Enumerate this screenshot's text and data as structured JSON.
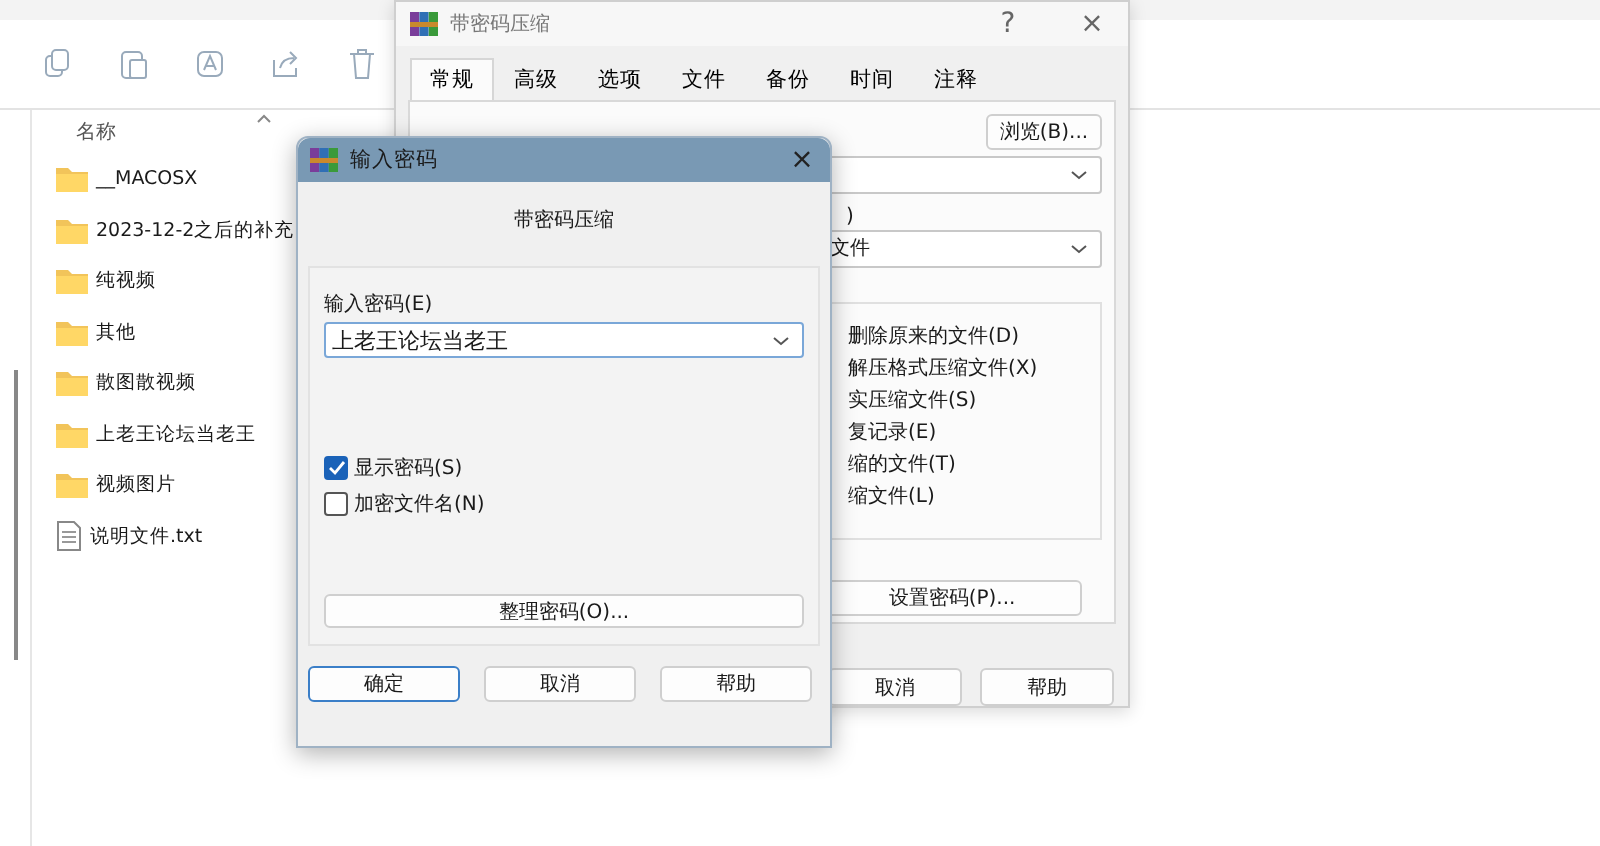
{
  "explorer": {
    "column_header": "名称",
    "items": [
      {
        "name": "__MACOSX",
        "kind": "folder"
      },
      {
        "name": "2023-12-2之后的补充",
        "kind": "folder"
      },
      {
        "name": "纯视频",
        "kind": "folder"
      },
      {
        "name": "其他",
        "kind": "folder"
      },
      {
        "name": "散图散视频",
        "kind": "folder"
      },
      {
        "name": "上老王论坛当老王",
        "kind": "folder"
      },
      {
        "name": "视频图片",
        "kind": "folder"
      },
      {
        "name": "说明文件.txt",
        "kind": "file"
      }
    ]
  },
  "archive_dialog": {
    "title": "带密码压缩",
    "help": "?",
    "close": "×",
    "tabs": [
      {
        "label": "常规",
        "selected": true
      },
      {
        "label": "高级",
        "selected": false
      },
      {
        "label": "选项",
        "selected": false
      },
      {
        "label": "文件",
        "selected": false
      },
      {
        "label": "备份",
        "selected": false
      },
      {
        "label": "时间",
        "selected": false
      },
      {
        "label": "注释",
        "selected": false
      }
    ],
    "browse_button": "浏览(B)...",
    "label_fragment": ")",
    "format_value": "文件",
    "options": [
      "删除原来的文件(D)",
      "解压格式压缩文件(X)",
      "实压缩文件(S)",
      "复记录(E)",
      "缩的文件(T)",
      "缩文件(L)"
    ],
    "set_password_button": "设置密码(P)...",
    "buttons": [
      "取消",
      "帮助"
    ]
  },
  "password_dialog": {
    "title": "输入密码",
    "close": "×",
    "heading": "带密码压缩",
    "password_label": "输入密码(E)",
    "password_value": "上老王论坛当老王",
    "checkboxes": [
      {
        "label": "显示密码(S)",
        "checked": true
      },
      {
        "label": "加密文件名(N)",
        "checked": false
      }
    ],
    "organize_button": "整理密码(O)...",
    "buttons": [
      {
        "label": "确定",
        "default": true
      },
      {
        "label": "取消",
        "default": false
      },
      {
        "label": "帮助",
        "default": false
      }
    ]
  }
}
